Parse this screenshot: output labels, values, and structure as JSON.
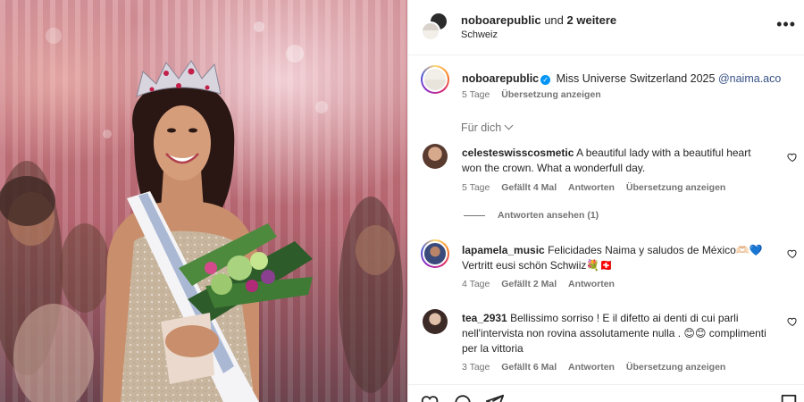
{
  "header": {
    "username": "noboarepublic",
    "connector": "und",
    "others": "2 weitere",
    "location": "Schweiz",
    "more_icon": "more-options-icon"
  },
  "caption": {
    "username": "noboarepublic",
    "text": "Miss Universe Switzerland 2025",
    "mention": "@naima.aco",
    "time": "5 Tage",
    "translate": "Übersetzung anzeigen"
  },
  "sort": {
    "label": "Für dich"
  },
  "comments": [
    {
      "username": "celesteswisscosmetic",
      "text": "A beautiful lady with a beautiful heart won the crown. What a wonderfull day.",
      "time": "5 Tage",
      "likes": "Gefällt 4 Mal",
      "reply": "Antworten",
      "translate": "Übersetzung anzeigen"
    },
    {
      "username": "lapamela_music",
      "text": "Felicidades Naima y saludos de México🫶🏻💙 Vertritt eusi schön Schwiiz💐🇨🇭",
      "time": "4 Tage",
      "likes": "Gefällt 2 Mal",
      "reply": "Antworten"
    },
    {
      "username": "tea_2931",
      "text": "Bellissimo sorriso ! E il difetto ai denti di cui parli nell'intervista non rovina assolutamente nulla . 😊😊 complimenti per la vittoria",
      "time": "3 Tage",
      "likes": "Gefällt 6 Mal",
      "reply": "Antworten",
      "translate": "Übersetzung anzeigen"
    }
  ],
  "view_replies": "Antworten ansehen (1)",
  "icons": [
    "like-icon",
    "comment-icon",
    "share-icon",
    "save-icon",
    "verified-icon",
    "heart-icon"
  ],
  "colors": {
    "verified": "#0095f6",
    "mention": "#385185",
    "secondary_text": "#737373",
    "primary_text": "#262626",
    "divider": "#efefef"
  }
}
